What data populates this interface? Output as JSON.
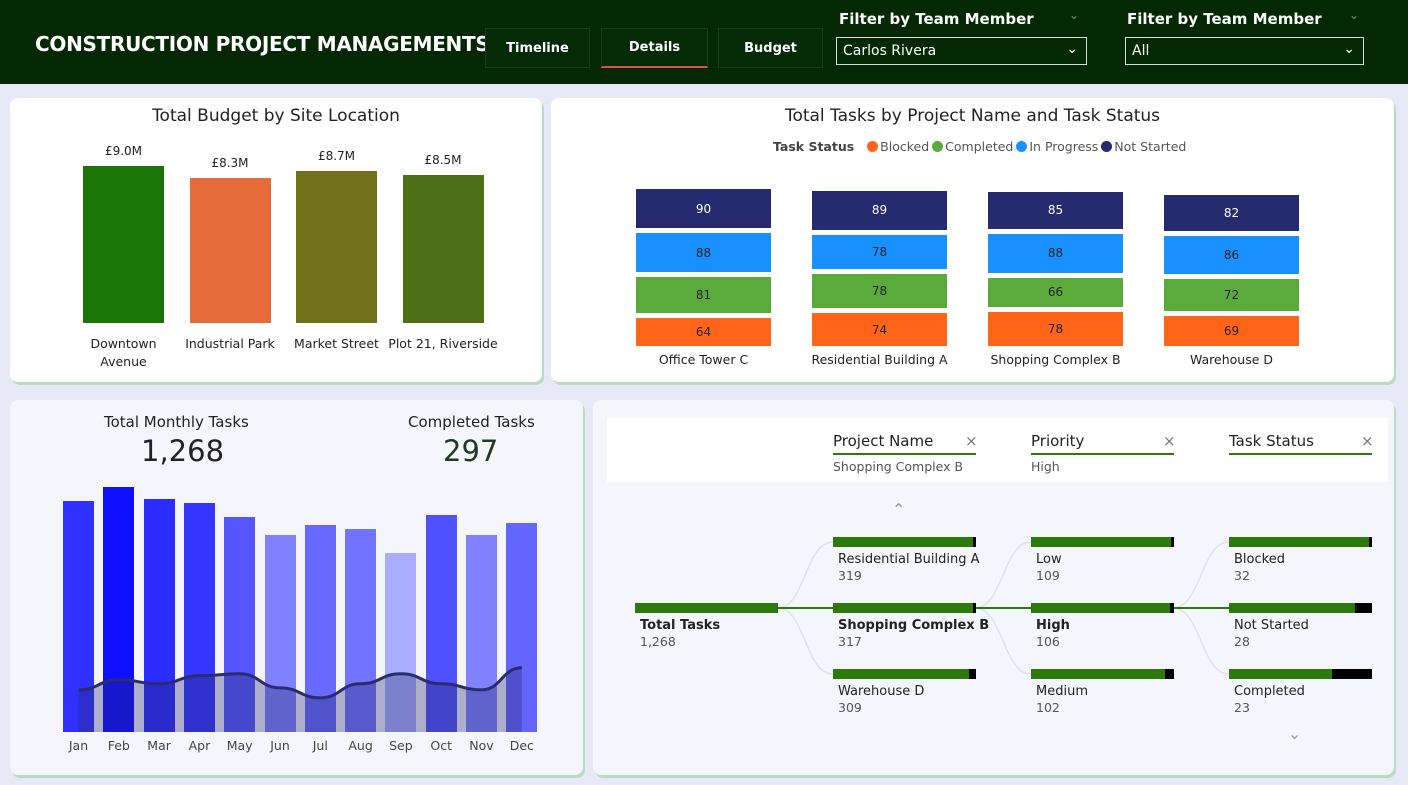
{
  "header": {
    "title": "CONSTRUCTION PROJECT MANAGEMENTS",
    "tabs": [
      {
        "label": "Timeline"
      },
      {
        "label": "Details"
      },
      {
        "label": "Budget"
      }
    ],
    "filters": [
      {
        "label": "Filter by Team Member",
        "value": "Carlos Rivera"
      },
      {
        "label": "Filter by Team Member",
        "value": "All"
      }
    ]
  },
  "budget_chart": {
    "title": "Total Budget by Site Location",
    "bar_colors": [
      "#1a7406",
      "#e56c38",
      "#717119",
      "#4d6f15"
    ]
  },
  "tasks_chart": {
    "title": "Total Tasks by Project Name and Task Status",
    "legend_title": "Task Status",
    "status_colors": {
      "Blocked": "#ff6418",
      "Completed": "#5aaa3c",
      "In Progress": "#1890ff",
      "Not Started": "#262a6e"
    }
  },
  "monthly": {
    "kpi_total_label": "Total Monthly Tasks",
    "kpi_total_value": "1,268",
    "kpi_completed_label": "Completed Tasks",
    "kpi_completed_value": "297"
  },
  "decomp": {
    "levels": [
      {
        "name": "Project Name",
        "value": "Shopping Complex B"
      },
      {
        "name": "Priority",
        "value": "High"
      },
      {
        "name": "Task Status",
        "value": ""
      }
    ],
    "root": {
      "label": "Total Tasks",
      "value": "1,268"
    },
    "projects": [
      {
        "label": "Residential Building A",
        "value": "319",
        "fraction": 0.98
      },
      {
        "label": "Shopping Complex B",
        "value": "317",
        "fraction": 0.98
      },
      {
        "label": "Warehouse D",
        "value": "309",
        "fraction": 0.95
      }
    ],
    "priorities": [
      {
        "label": "Low",
        "value": "109",
        "fraction": 1.0
      },
      {
        "label": "High",
        "value": "106",
        "fraction": 0.97
      },
      {
        "label": "Medium",
        "value": "102",
        "fraction": 0.94
      }
    ],
    "statuses": [
      {
        "label": "Blocked",
        "value": "32",
        "fraction": 1.0
      },
      {
        "label": "Not Started",
        "value": "28",
        "fraction": 0.88
      },
      {
        "label": "Completed",
        "value": "23",
        "fraction": 0.72
      }
    ]
  },
  "chart_data": [
    {
      "type": "bar",
      "title": "Total Budget by Site Location",
      "categories": [
        "Downtown Avenue",
        "Industrial Park",
        "Market Street",
        "Plot 21, Riverside"
      ],
      "values": [
        9.0,
        8.3,
        8.7,
        8.5
      ],
      "labels": [
        "£9.0M",
        "£8.3M",
        "£8.7M",
        "£8.5M"
      ],
      "ylim": [
        0,
        9.0
      ]
    },
    {
      "type": "bar",
      "title": "Total Tasks by Project Name and Task Status",
      "stacked": true,
      "categories": [
        "Office Tower C",
        "Residential Building A",
        "Shopping Complex B",
        "Warehouse D"
      ],
      "series": [
        {
          "name": "Blocked",
          "values": [
            64,
            74,
            78,
            69
          ]
        },
        {
          "name": "Completed",
          "values": [
            81,
            78,
            66,
            72
          ]
        },
        {
          "name": "In Progress",
          "values": [
            88,
            78,
            88,
            86
          ]
        },
        {
          "name": "Not Started",
          "values": [
            90,
            89,
            85,
            82
          ]
        }
      ]
    },
    {
      "type": "bar",
      "title": "",
      "categories": [
        "Jan",
        "Feb",
        "Mar",
        "Apr",
        "May",
        "Jun",
        "Jul",
        "Aug",
        "Sep",
        "Oct",
        "Nov",
        "Dec"
      ],
      "series": [
        {
          "values": [
            115,
            122,
            116,
            114,
            107,
            98,
            103,
            101,
            89,
            108,
            98,
            104
          ]
        },
        {
          "values": [
            21,
            26,
            24,
            28,
            29,
            22,
            17,
            24,
            29,
            24,
            21,
            32
          ]
        }
      ],
      "ylim": [
        0,
        130
      ]
    }
  ]
}
